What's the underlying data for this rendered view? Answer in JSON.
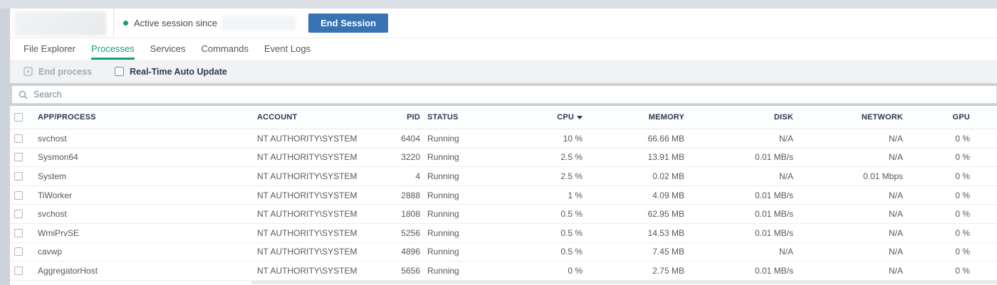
{
  "session_bar": {
    "status_text": "Active session since",
    "end_session_label": "End Session"
  },
  "tabs": [
    {
      "label": "File Explorer",
      "active": false
    },
    {
      "label": "Processes",
      "active": true
    },
    {
      "label": "Services",
      "active": false
    },
    {
      "label": "Commands",
      "active": false
    },
    {
      "label": "Event Logs",
      "active": false
    }
  ],
  "toolbar": {
    "end_process_label": "End process",
    "auto_update_label": "Real-Time Auto Update",
    "auto_update_checked": false
  },
  "search": {
    "placeholder": "Search",
    "value": ""
  },
  "table": {
    "columns": {
      "app": "APP/PROCESS",
      "account": "ACCOUNT",
      "pid": "PID",
      "status": "STATUS",
      "cpu": "CPU",
      "memory": "MEMORY",
      "disk": "DISK",
      "network": "NETWORK",
      "gpu": "GPU"
    },
    "sorted_by": "cpu",
    "sort_direction": "desc",
    "rows": [
      {
        "app": "svchost",
        "account": "NT AUTHORITY\\SYSTEM",
        "pid": "6404",
        "status": "Running",
        "cpu": "10 %",
        "memory": "66.66 MB",
        "disk": "N/A",
        "network": "N/A",
        "gpu": "0 %"
      },
      {
        "app": "Sysmon64",
        "account": "NT AUTHORITY\\SYSTEM",
        "pid": "3220",
        "status": "Running",
        "cpu": "2.5 %",
        "memory": "13.91 MB",
        "disk": "0.01 MB/s",
        "network": "N/A",
        "gpu": "0 %"
      },
      {
        "app": "System",
        "account": "NT AUTHORITY\\SYSTEM",
        "pid": "4",
        "status": "Running",
        "cpu": "2.5 %",
        "memory": "0.02 MB",
        "disk": "N/A",
        "network": "0.01 Mbps",
        "gpu": "0 %"
      },
      {
        "app": "TiWorker",
        "account": "NT AUTHORITY\\SYSTEM",
        "pid": "2888",
        "status": "Running",
        "cpu": "1 %",
        "memory": "4.09 MB",
        "disk": "0.01 MB/s",
        "network": "N/A",
        "gpu": "0 %"
      },
      {
        "app": "svchost",
        "account": "NT AUTHORITY\\SYSTEM",
        "pid": "1808",
        "status": "Running",
        "cpu": "0.5 %",
        "memory": "62.95 MB",
        "disk": "0.01 MB/s",
        "network": "N/A",
        "gpu": "0 %"
      },
      {
        "app": "WmiPrvSE",
        "account": "NT AUTHORITY\\SYSTEM",
        "pid": "5256",
        "status": "Running",
        "cpu": "0.5 %",
        "memory": "14.53 MB",
        "disk": "0.01 MB/s",
        "network": "N/A",
        "gpu": "0 %"
      },
      {
        "app": "cavwp",
        "account": "NT AUTHORITY\\SYSTEM",
        "pid": "4896",
        "status": "Running",
        "cpu": "0.5 %",
        "memory": "7.45 MB",
        "disk": "N/A",
        "network": "N/A",
        "gpu": "0 %"
      },
      {
        "app": "AggregatorHost",
        "account": "NT AUTHORITY\\SYSTEM",
        "pid": "5656",
        "status": "Running",
        "cpu": "0 %",
        "memory": "2.75 MB",
        "disk": "0.01 MB/s",
        "network": "N/A",
        "gpu": "0 %"
      }
    ]
  },
  "colors": {
    "accent_green": "#16a07c",
    "accent_blue": "#3873b3",
    "chrome_gray": "#ccd3da",
    "toolbar_gray": "#f0f2f4",
    "search_band_gray": "#c9d0d7",
    "header_text": "#2a3752"
  }
}
